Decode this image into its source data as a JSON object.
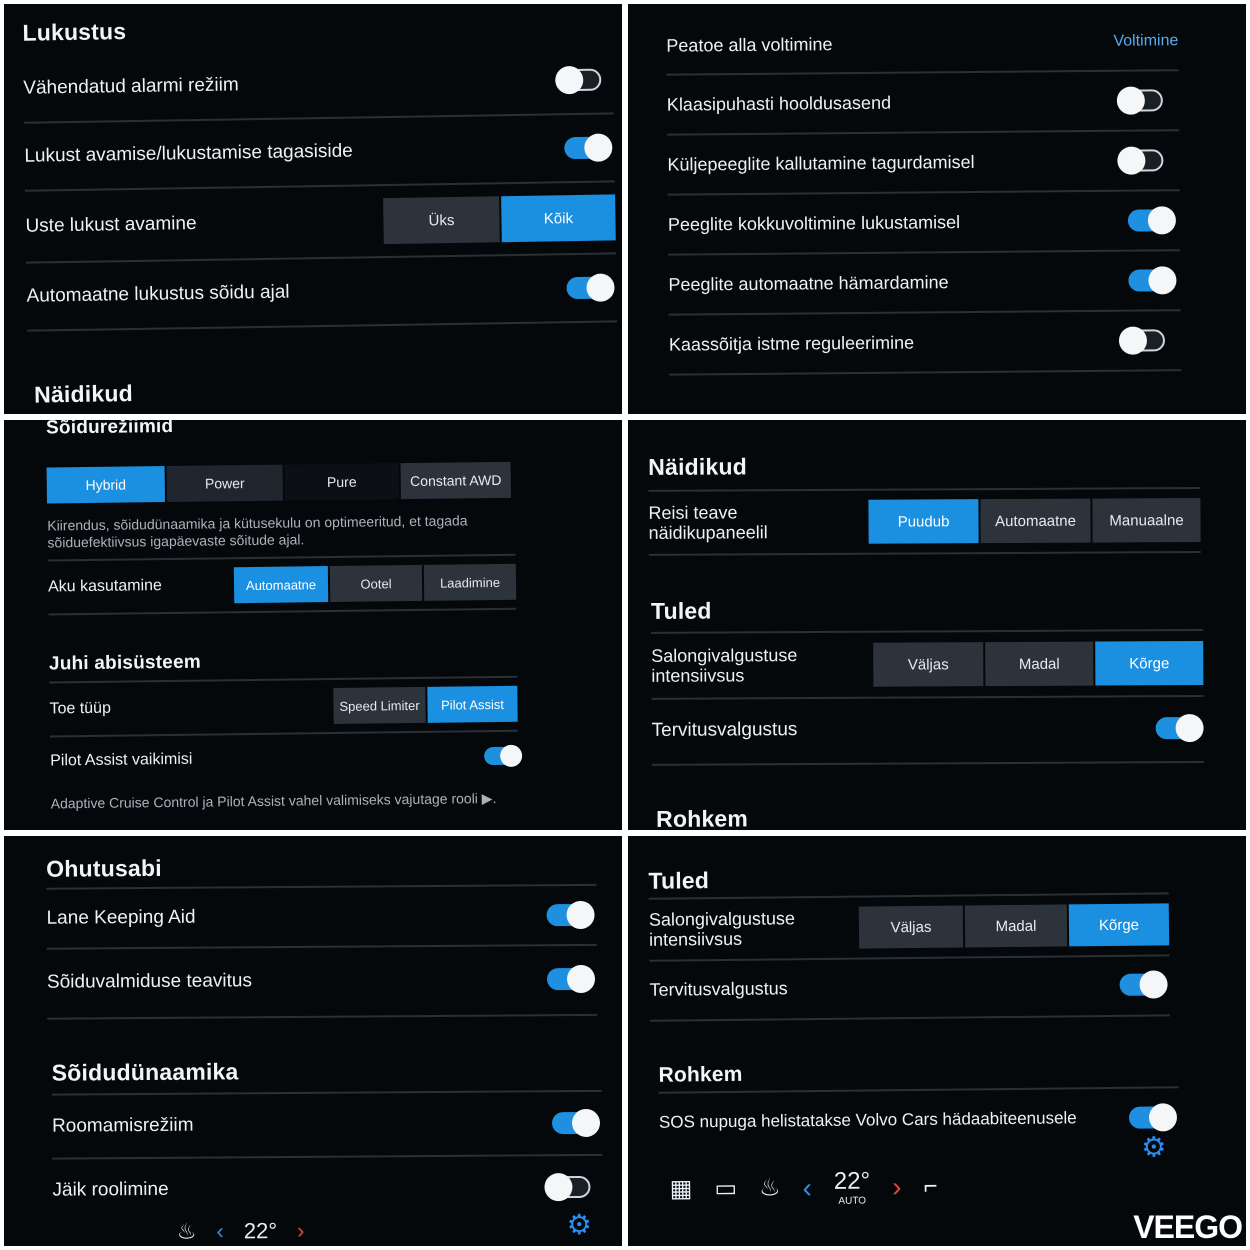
{
  "p1": {
    "heading": "Lukustus",
    "rows": [
      {
        "label": "Vähendatud alarmi režiim",
        "toggle": "off"
      },
      {
        "label": "Lukust avamise/lukustamise tagasiside",
        "toggle": "on"
      },
      {
        "label": "Uste lukust avamine",
        "options": [
          "Üks",
          "Kõik"
        ],
        "selected": "Kõik"
      },
      {
        "label": "Automaatne lukustus sõidu ajal",
        "toggle": "on"
      }
    ],
    "heading2": "Näidikud"
  },
  "p2": {
    "rows": [
      {
        "label": "Peatoe alla voltimine",
        "link": "Voltimine"
      },
      {
        "label": "Klaasipuhasti hooldusasend",
        "toggle": "off"
      },
      {
        "label": "Küljepeeglite kallutamine tagurdamisel",
        "toggle": "off"
      },
      {
        "label": "Peeglite kokkuvoltimine lukustamisel",
        "toggle": "on"
      },
      {
        "label": "Peeglite automaatne hämardamine",
        "toggle": "on"
      },
      {
        "label": "Kaassõitja istme reguleerimine",
        "toggle": "off"
      }
    ]
  },
  "p3": {
    "heading": "Sõidurežiimid",
    "modes": [
      "Hybrid",
      "Power",
      "Pure",
      "Constant AWD"
    ],
    "mode_selected": "Hybrid",
    "mode_desc": "Kiirendus, sõidudünaamika ja kütusekulu on optimeeritud, et tagada sõiduefektiivsus igapäevaste sõitude ajal.",
    "battery_label": "Aku kasutamine",
    "battery_options": [
      "Automaatne",
      "Ootel",
      "Laadimine"
    ],
    "battery_selected": "Automaatne",
    "heading2": "Juhi abisüsteem",
    "support_label": "Toe tüüp",
    "support_options": [
      "Speed Limiter",
      "Pilot Assist"
    ],
    "support_selected": "Pilot Assist",
    "pilot_label": "Pilot Assist vaikimisi",
    "pilot_toggle": "on",
    "footer_desc": "Adaptive Cruise Control ja Pilot Assist vahel valimiseks vajutage rooli ▶."
  },
  "p4": {
    "heading": "Näidikud",
    "trip_label": "Reisi teave näidikupaneelil",
    "trip_options": [
      "Puudub",
      "Automaatne",
      "Manuaalne"
    ],
    "trip_selected": "Puudub",
    "heading2": "Tuled",
    "interior_label": "Salongivalgustuse intensiivsus",
    "interior_options": [
      "Väljas",
      "Madal",
      "Kõrge"
    ],
    "interior_selected": "Kõrge",
    "welcome_label": "Tervitusvalgustus",
    "welcome_toggle": "on",
    "heading3": "Rohkem"
  },
  "p5": {
    "heading": "Ohutusabi",
    "rows": [
      {
        "label": "Lane Keeping Aid",
        "toggle": "on"
      },
      {
        "label": "Sõiduvalmiduse teavitus",
        "toggle": "on"
      }
    ],
    "heading2": "Sõidudünaamika",
    "rows2": [
      {
        "label": "Roomamisrežiim",
        "toggle": "on"
      },
      {
        "label": "Jäik roolimine",
        "toggle": "off"
      }
    ],
    "temp": "22°"
  },
  "p6": {
    "heading": "Tuled",
    "interior_label": "Salongivalgustuse intensiivsus",
    "interior_options": [
      "Väljas",
      "Madal",
      "Kõrge"
    ],
    "interior_selected": "Kõrge",
    "welcome_label": "Tervitusvalgustus",
    "welcome_toggle": "on",
    "heading2": "Rohkem",
    "sos_label": "SOS nupuga helistatakse Volvo Cars hädaabiteenusele",
    "sos_toggle": "on",
    "temp": "22°",
    "temp_mode": "AUTO"
  },
  "watermark": "VEEGO",
  "colors": {
    "accent": "#1b8fe0",
    "bg": "#05080b",
    "segment": "#2c333b"
  }
}
